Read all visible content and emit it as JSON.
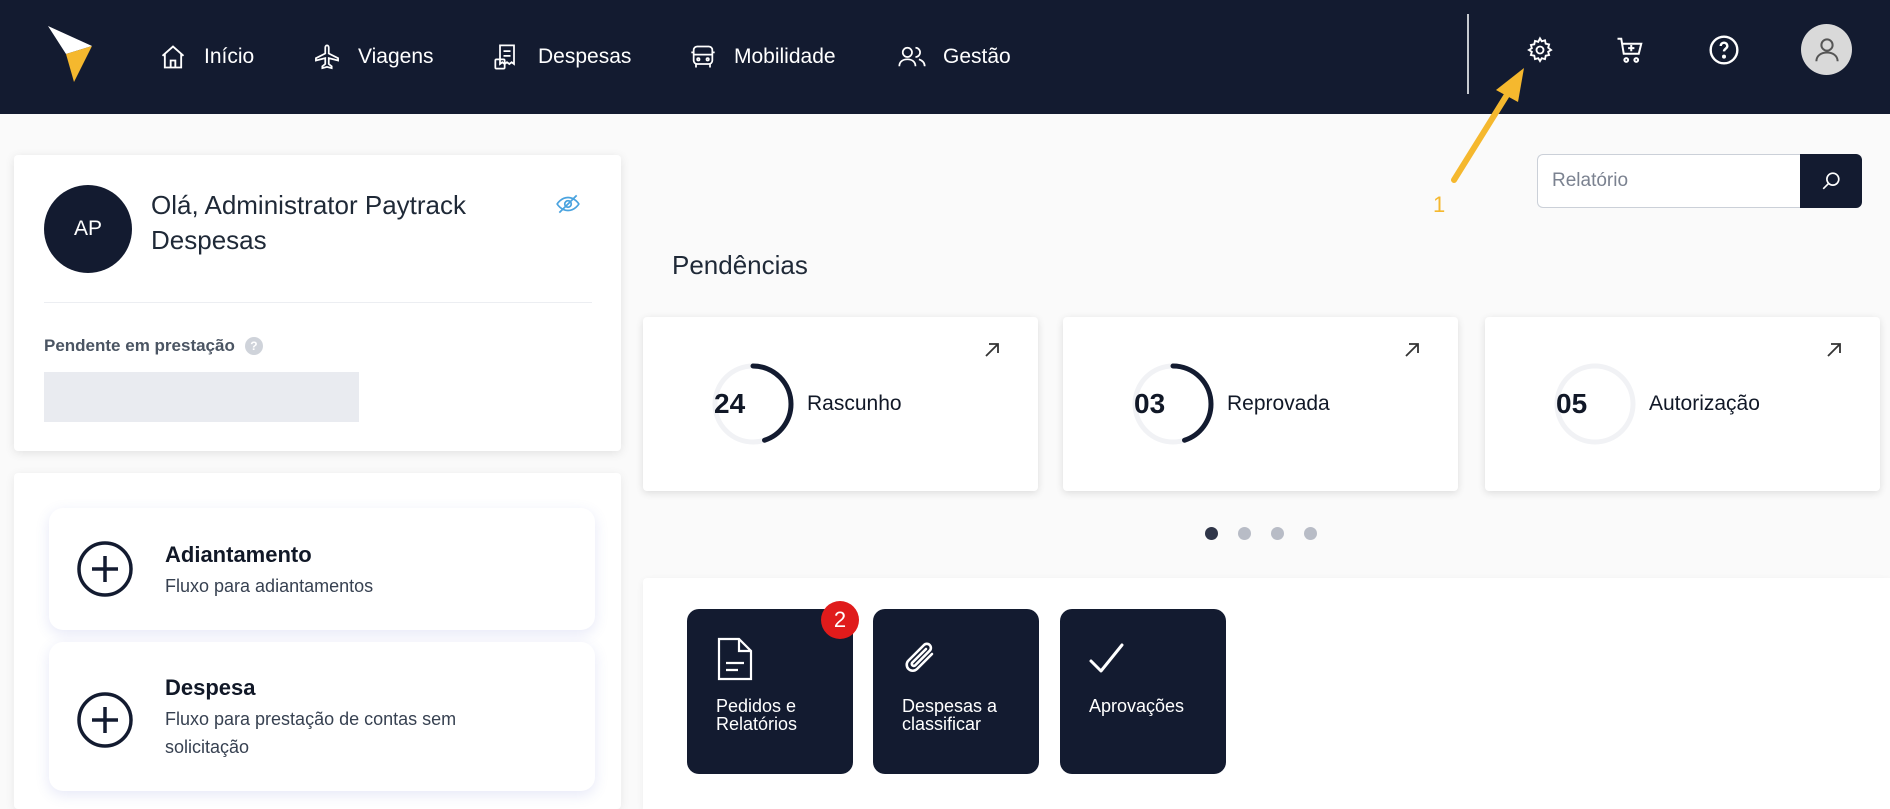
{
  "nav": {
    "items": [
      {
        "label": "Início",
        "icon": "home-icon"
      },
      {
        "label": "Viagens",
        "icon": "airplane-icon"
      },
      {
        "label": "Despesas",
        "icon": "receipt-icon"
      },
      {
        "label": "Mobilidade",
        "icon": "car-icon"
      },
      {
        "label": "Gestão",
        "icon": "users-icon"
      }
    ],
    "right_icons": [
      "gear-icon",
      "cart-icon",
      "help-icon",
      "user-icon"
    ]
  },
  "profile": {
    "initials": "AP",
    "greeting": "Olá, Administrator Paytrack Despesas",
    "pending_label": "Pendente em prestação",
    "pending_help": "?"
  },
  "actions": [
    {
      "title": "Adiantamento",
      "description": "Fluxo para adiantamentos"
    },
    {
      "title": "Despesa",
      "description": "Fluxo para prestação de contas sem solicitação"
    }
  ],
  "search": {
    "placeholder": "Relatório",
    "value": ""
  },
  "annotation": {
    "number": "1",
    "color": "#f5b82e"
  },
  "pendencias": {
    "title": "Pendências",
    "cards": [
      {
        "count": "24",
        "label": "Rascunho",
        "progress": 0.45
      },
      {
        "count": "03",
        "label": "Reprovada",
        "progress": 0.45
      },
      {
        "count": "05",
        "label": "Autorização",
        "progress": 0.0
      }
    ],
    "pages": 4,
    "active_page": 1
  },
  "tiles": [
    {
      "label": "Pedidos e Relatórios",
      "badge": "2",
      "icon": "document-icon"
    },
    {
      "label": "Despesas a classificar",
      "icon": "paperclip-icon"
    },
    {
      "label": "Aprovações",
      "icon": "check-icon"
    }
  ],
  "colors": {
    "navy": "#131b30",
    "brand_yellow": "#f5b82e",
    "badge_red": "#e01b1b",
    "eye_blue": "#4aa3df"
  }
}
